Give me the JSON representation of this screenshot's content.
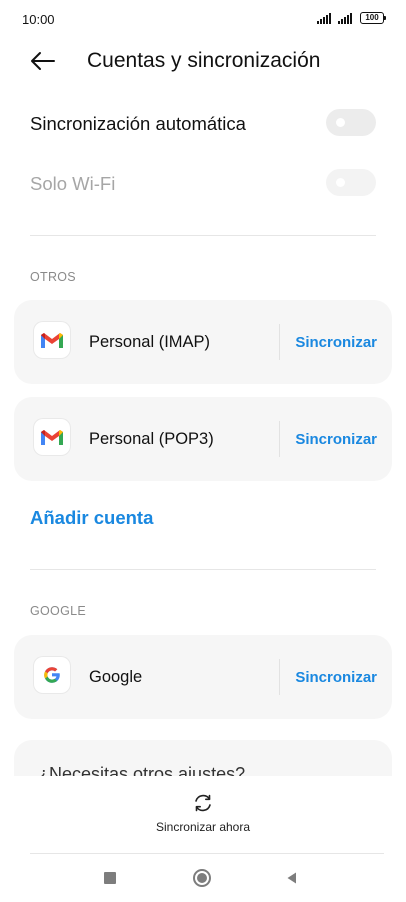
{
  "status_bar": {
    "time": "10:00",
    "battery": "100"
  },
  "header": {
    "title": "Cuentas y sincronización"
  },
  "settings": {
    "auto_sync_label": "Sincronización automática",
    "wifi_only_label": "Solo Wi-Fi",
    "auto_sync_on": false,
    "wifi_only_on": false
  },
  "sections": {
    "otros": {
      "header": "OTROS",
      "accounts": [
        {
          "name": "Personal (IMAP)",
          "icon": "gmail-icon",
          "action": "Sincronizar"
        },
        {
          "name": "Personal (POP3)",
          "icon": "gmail-icon",
          "action": "Sincronizar"
        }
      ],
      "add_account": "Añadir cuenta"
    },
    "google": {
      "header": "GOOGLE",
      "accounts": [
        {
          "name": "Google",
          "icon": "google-icon",
          "action": "Sincronizar"
        }
      ]
    }
  },
  "help": {
    "text": "¿Necesitas otros ajustes?"
  },
  "bottom": {
    "sync_now_label": "Sincronizar ahora",
    "sync_now_icon": "sync-icon"
  },
  "navbar": {
    "items": [
      "recents-icon",
      "home-icon",
      "back-icon"
    ]
  },
  "colors": {
    "accent": "#1a88e0",
    "card_bg": "#f6f6f6",
    "muted_text": "#a6a6a6"
  }
}
